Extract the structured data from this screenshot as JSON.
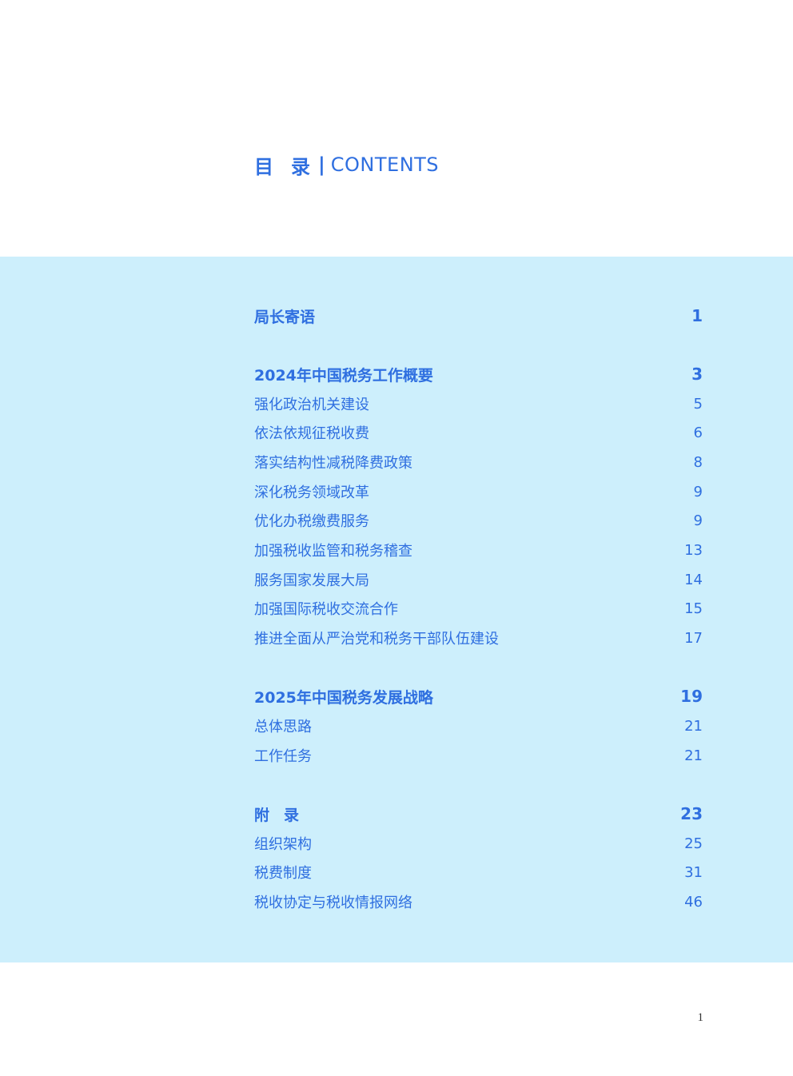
{
  "heading": {
    "cn": "目录",
    "separator": "|",
    "en": "CONTENTS"
  },
  "toc": [
    {
      "title": "局长寄语",
      "page": "1",
      "level": 1
    },
    {
      "title": "2024年中国税务工作概要",
      "page": "3",
      "level": 1
    },
    {
      "title": "强化政治机关建设",
      "page": "5",
      "level": 2
    },
    {
      "title": "依法依规征税收费",
      "page": "6",
      "level": 2
    },
    {
      "title": "落实结构性减税降费政策",
      "page": "8",
      "level": 2
    },
    {
      "title": "深化税务领域改革",
      "page": "9",
      "level": 2
    },
    {
      "title": "优化办税缴费服务",
      "page": "9",
      "level": 2
    },
    {
      "title": "加强税收监管和税务稽查",
      "page": "13",
      "level": 2
    },
    {
      "title": "服务国家发展大局",
      "page": "14",
      "level": 2
    },
    {
      "title": "加强国际税收交流合作",
      "page": "15",
      "level": 2
    },
    {
      "title": "推进全面从严治党和税务干部队伍建设",
      "page": "17",
      "level": 2
    },
    {
      "title": "2025年中国税务发展战略",
      "page": "19",
      "level": 1
    },
    {
      "title": "总体思路",
      "page": "21",
      "level": 2
    },
    {
      "title": "工作任务",
      "page": "21",
      "level": 2
    },
    {
      "title": "附录",
      "page": "23",
      "level": 1
    },
    {
      "title": "组织架构",
      "page": "25",
      "level": 2
    },
    {
      "title": "税费制度",
      "page": "31",
      "level": 2
    },
    {
      "title": "税收协定与税收情报网络",
      "page": "46",
      "level": 2
    }
  ],
  "folio": "1",
  "colors": {
    "accent": "#2f6fe0",
    "panel": "#cdeffc",
    "folio": "#333333"
  }
}
